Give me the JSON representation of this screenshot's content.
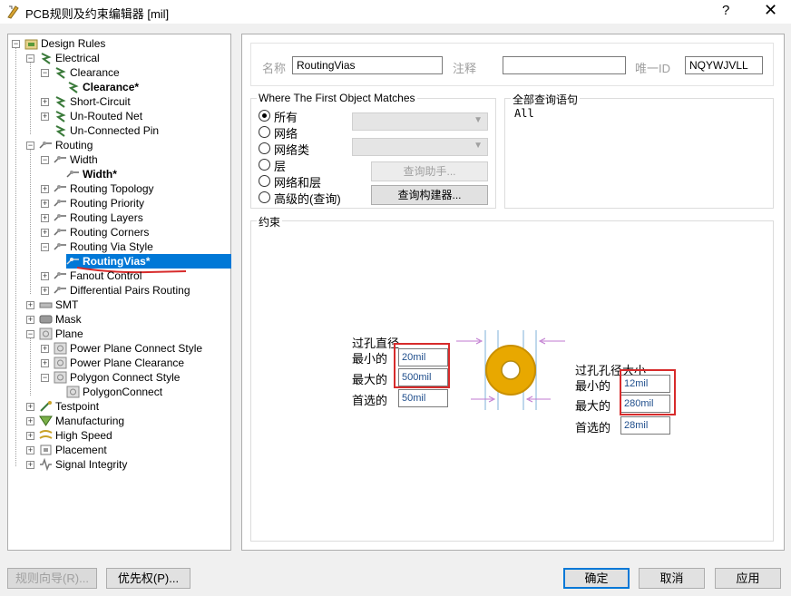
{
  "window": {
    "title": "PCB规则及约束编辑器 [mil]",
    "help": "?",
    "close": "✕"
  },
  "tree": {
    "design_rules": "Design Rules",
    "electrical": "Electrical",
    "clearance": "Clearance",
    "clearance_rule": "Clearance*",
    "short_circuit": "Short-Circuit",
    "un_routed_net": "Un-Routed Net",
    "un_connected_pin": "Un-Connected Pin",
    "routing": "Routing",
    "width": "Width",
    "width_rule": "Width*",
    "routing_topology": "Routing Topology",
    "routing_priority": "Routing Priority",
    "routing_layers": "Routing Layers",
    "routing_corners": "Routing Corners",
    "routing_via_style": "Routing Via Style",
    "routing_vias": "RoutingVias*",
    "fanout_control": "Fanout Control",
    "differential_pairs": "Differential Pairs Routing",
    "smt": "SMT",
    "mask": "Mask",
    "plane": "Plane",
    "power_plane_connect": "Power Plane Connect Style",
    "power_plane_clearance": "Power Plane Clearance",
    "polygon_connect_style": "Polygon Connect Style",
    "polygon_connect": "PolygonConnect",
    "testpoint": "Testpoint",
    "manufacturing": "Manufacturing",
    "high_speed": "High Speed",
    "placement": "Placement",
    "signal_integrity": "Signal Integrity"
  },
  "header": {
    "name_label": "名称",
    "name_value": "RoutingVias",
    "comment_label": "注释",
    "comment_value": "",
    "id_label": "唯一ID",
    "id_value": "NQYWJVLL"
  },
  "match": {
    "title": "Where The First Object Matches",
    "options": [
      "所有",
      "网络",
      "网络类",
      "层",
      "网络和层",
      "高级的(查询)"
    ],
    "query_helper": "查询助手...",
    "query_builder": "查询构建器..."
  },
  "query": {
    "title": "全部查询语句",
    "text": "All"
  },
  "constraints": {
    "title": "约束",
    "via_diameter": {
      "title": "过孔直径",
      "min_label": "最小的",
      "max_label": "最大的",
      "pref_label": "首选的",
      "min": "20mil",
      "max": "500mil",
      "pref": "50mil"
    },
    "hole_size": {
      "title": "过孔孔径大小",
      "min_label": "最小的",
      "max_label": "最大的",
      "pref_label": "首选的",
      "min": "12mil",
      "max": "280mil",
      "pref": "28mil"
    }
  },
  "footer": {
    "wizard": "规则向导(R)...",
    "priority": "优先权(P)...",
    "ok": "确定",
    "cancel": "取消",
    "apply": "应用"
  },
  "colors": {
    "selection": "#0078d7",
    "highlight": "#d72b2b",
    "via": "#e8a800"
  }
}
